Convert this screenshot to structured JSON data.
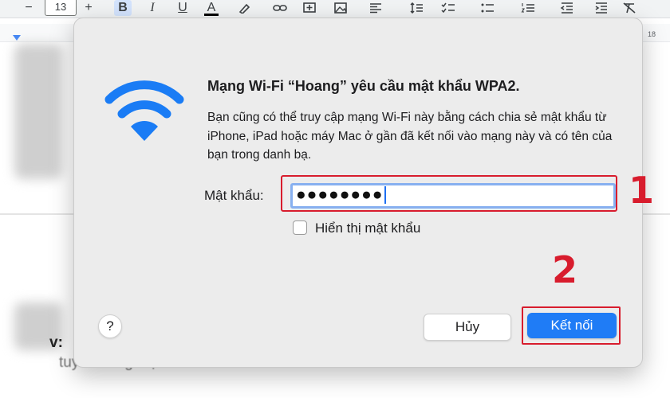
{
  "toolbar": {
    "font_size": "13",
    "minus_icon": "minus-icon",
    "plus_icon": "plus-icon",
    "bold": "B",
    "italic": "I",
    "underline": "U",
    "text_color": "A"
  },
  "ruler": {
    "number": "18"
  },
  "background_doc": {
    "line1": "v:",
    "line2": "tuy thương hiệu."
  },
  "dialog": {
    "title": "Mạng Wi-Fi “Hoang” yêu cầu mật khẩu WPA2.",
    "description": "Bạn cũng có thể truy cập mạng Wi-Fi này bằng cách chia sẻ mật khẩu từ iPhone, iPad hoặc máy Mac ở gần đã kết nối vào mạng này và có tên của bạn trong danh bạ.",
    "password_label": "Mật khẩu:",
    "password_value": "●●●●●●●●",
    "show_password_label": "Hiển thị mật khẩu",
    "show_password_checked": false,
    "help_label": "?",
    "cancel_label": "Hủy",
    "connect_label": "Kết nối"
  },
  "annotations": {
    "step1": "1",
    "step2": "2"
  },
  "colors": {
    "accent": "#1f7cf6",
    "wifi_icon": "#1a7cf5",
    "annotation": "#d81c2d",
    "dialog_bg": "#ececec"
  }
}
